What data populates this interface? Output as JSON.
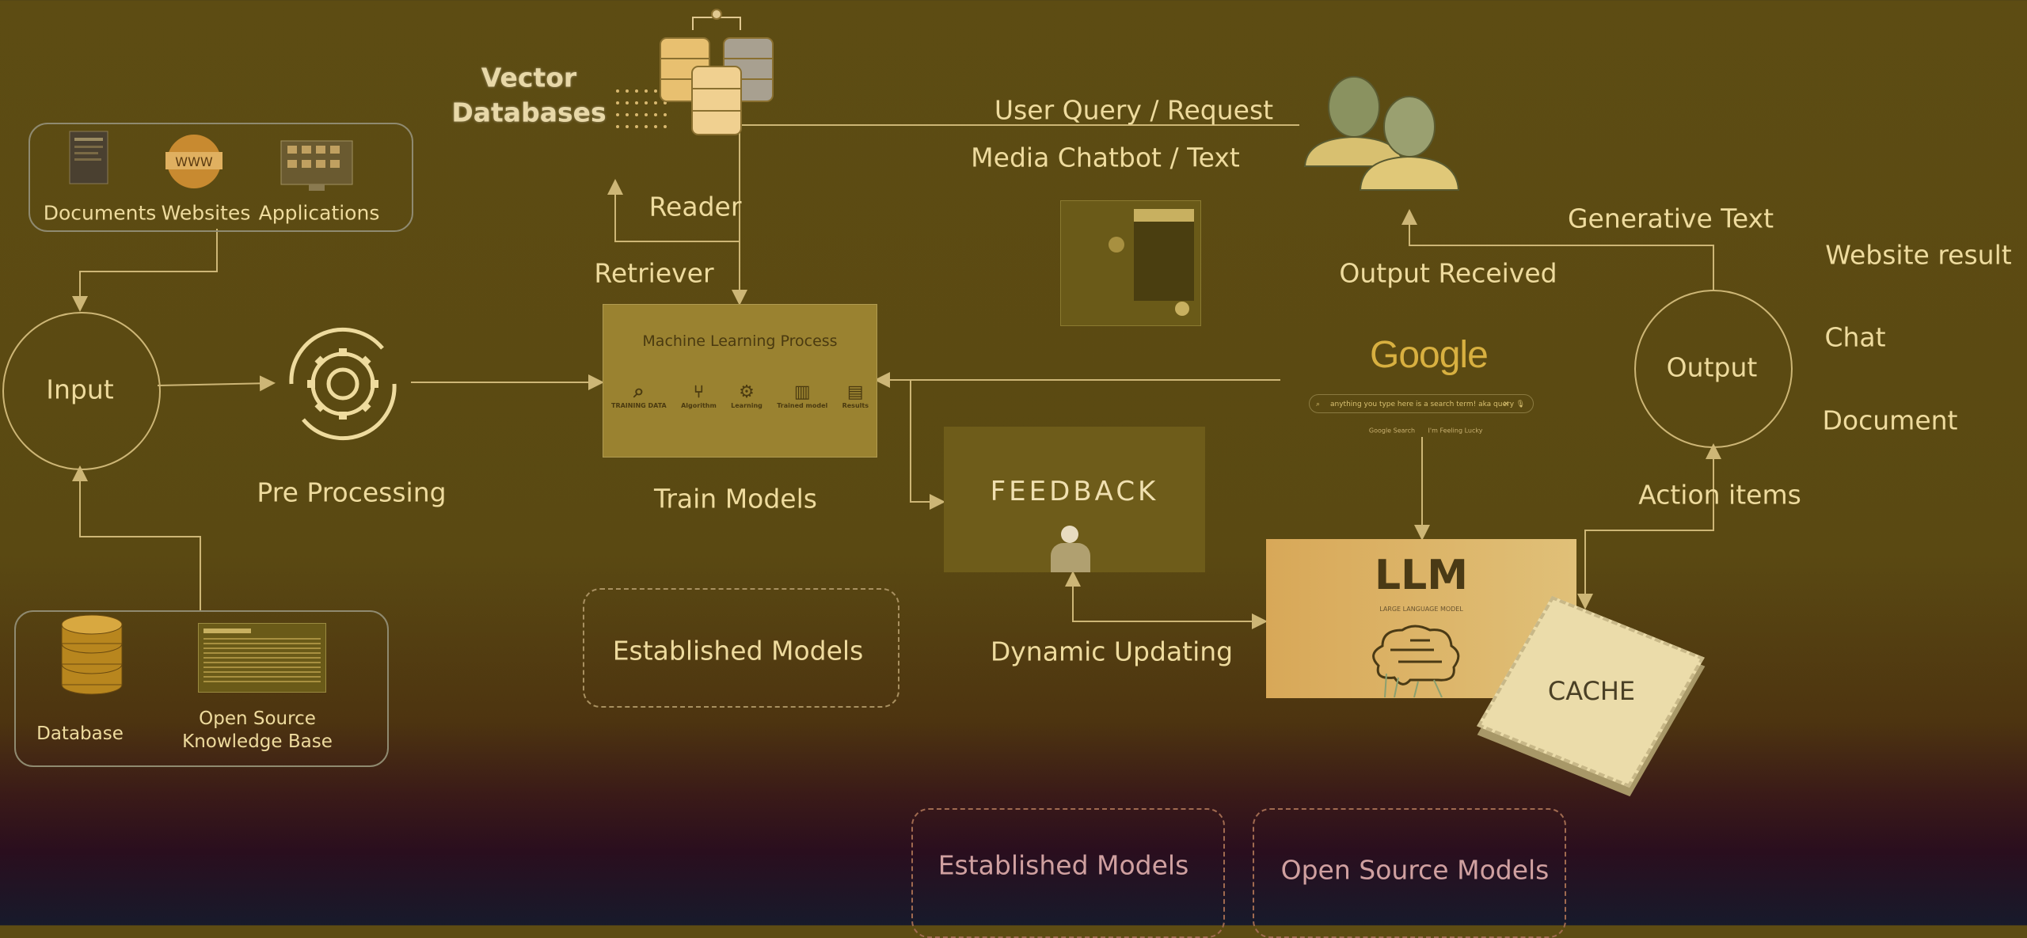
{
  "sources": {
    "documents": "Documents",
    "websites": "Websites",
    "applications": "Applications",
    "www": "WWW"
  },
  "storage": {
    "database": "Database",
    "knowledge_base_line1": "Open Source",
    "knowledge_base_line2": "Knowledge Base"
  },
  "input": "Input",
  "pre_processing": "Pre Processing",
  "vector_db": {
    "line1": "Vector",
    "line2": "Databases"
  },
  "reader": "Reader",
  "retriever": "Retriever",
  "ml_process": {
    "title": "Machine Learning Process",
    "steps": [
      "TRAINING DATA",
      "Algorithm",
      "Learning",
      "Trained model",
      "Results"
    ]
  },
  "train_models": "Train Models",
  "established_models_mid": "Established Models",
  "user_query": "User Query / Request",
  "media_chatbot": "Media Chatbot / Text",
  "output_received": "Output Received",
  "google": {
    "logo": "Google",
    "query": "anything you type here is a search term! aka query",
    "btn_search": "Google Search",
    "btn_lucky": "I'm Feeling Lucky"
  },
  "feedback": "FEEDBACK",
  "dynamic_updating": "Dynamic Updating",
  "llm": {
    "title": "LLM",
    "subtitle": "LARGE LANGUAGE MODEL"
  },
  "cache": "CACHE",
  "output": {
    "label": "Output",
    "generative_text": "Generative Text",
    "website_result": "Website result",
    "chat": "Chat",
    "document": "Document",
    "action_items": "Action items"
  },
  "bottom": {
    "established_models": "Established Models",
    "open_source_models": "Open Source Models"
  },
  "colors": {
    "line": "#cdb676",
    "text": "#eedb9e",
    "bottom_text": "#d0a0a0"
  }
}
